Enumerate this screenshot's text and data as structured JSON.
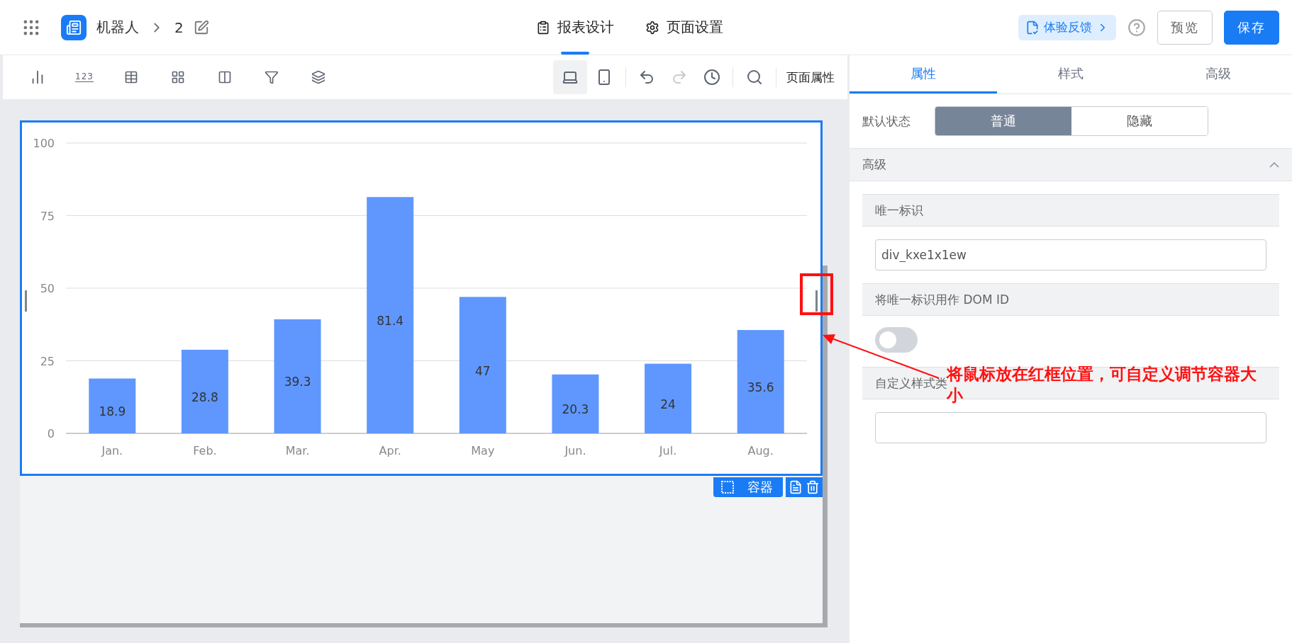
{
  "header": {
    "app_name": "机器人",
    "page_name": "2",
    "tabs": [
      {
        "label": "报表设计",
        "kind": "design",
        "selected": true
      },
      {
        "label": "页面设置",
        "kind": "settings",
        "selected": false
      }
    ],
    "feedback": "体验反馈",
    "buttons": [
      {
        "label": "预览",
        "kind": "secondary"
      },
      {
        "label": "保存",
        "kind": "primary"
      }
    ]
  },
  "toolbar": {
    "widgets": [
      {
        "kind": "chart"
      },
      {
        "kind": "number",
        "label": "123"
      },
      {
        "kind": "table"
      },
      {
        "kind": "grid"
      },
      {
        "kind": "columns"
      },
      {
        "kind": "filter"
      },
      {
        "kind": "layers"
      }
    ],
    "devices": [
      {
        "kind": "desktop",
        "selected": true
      },
      {
        "kind": "mobile",
        "selected": false
      }
    ],
    "history": [
      {
        "kind": "undo",
        "disabled": false
      },
      {
        "kind": "redo",
        "disabled": true
      },
      {
        "kind": "clock",
        "disabled": false
      }
    ],
    "page_properties": "页面属性"
  },
  "canvas": {
    "container_label": "容器",
    "chart_data": {
      "type": "bar",
      "categories": [
        "Jan.",
        "Feb.",
        "Mar.",
        "Apr.",
        "May",
        "Jun.",
        "Jul.",
        "Aug."
      ],
      "values": [
        18.9,
        28.8,
        39.3,
        81.4,
        47,
        20.3,
        24,
        35.6
      ],
      "value_labels": [
        "18.9",
        "28.8",
        "39.3",
        "81.4",
        "47",
        "20.3",
        "24",
        "35.6"
      ],
      "ylim": [
        0,
        100
      ],
      "grid": true,
      "yticks": [
        0,
        25,
        50,
        75,
        100
      ],
      "data_labels": true
    }
  },
  "panel": {
    "tabs": [
      {
        "label": "属性",
        "selected": true
      },
      {
        "label": "样式",
        "selected": false
      },
      {
        "label": "高级",
        "selected": false
      }
    ],
    "default_state": {
      "label": "默认状态",
      "options": [
        {
          "label": "普通",
          "selected": true
        },
        {
          "label": "隐藏",
          "selected": false
        }
      ]
    },
    "section": {
      "title": "高级",
      "expanded": true
    },
    "unique_id": {
      "label": "唯一标识",
      "value": "div_kxe1x1ew"
    },
    "use_as_dom_id": {
      "label": "将唯一标识用作 DOM ID",
      "on": false
    },
    "custom_class": {
      "label": "自定义样式类"
    }
  },
  "annotation": {
    "text": "将鼠标放在红框位置，可自定义调节容器大小"
  }
}
